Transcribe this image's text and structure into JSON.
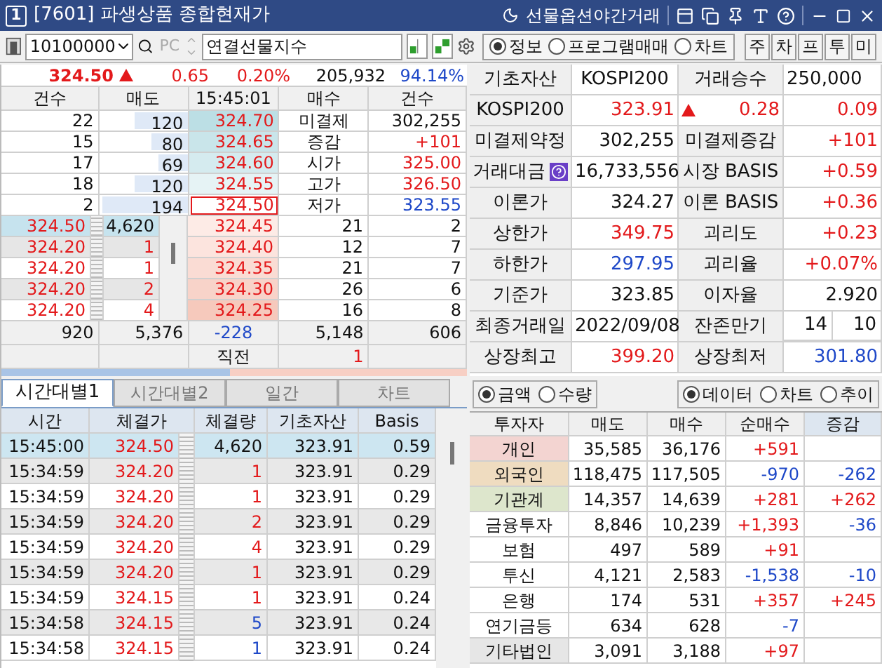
{
  "title_bar": {
    "number": "1",
    "title": "[7601] 파생상품 종합현재가",
    "night_label": "선물옵션야간거래"
  },
  "toolbar": {
    "code": "10100000",
    "pc_button": {
      "label": "PC",
      "disabled": true
    },
    "name": "연결선물지수",
    "views": [
      {
        "label": "정보",
        "selected": true
      },
      {
        "label": "프로그램매매",
        "selected": false
      },
      {
        "label": "차트",
        "selected": false
      }
    ],
    "quick_buttons": [
      "주",
      "차",
      "프",
      "투",
      "미"
    ]
  },
  "summary": {
    "price": {
      "text": "324.50",
      "color": "#e3191b"
    },
    "rising": true,
    "change": {
      "text": "0.65",
      "color": "#e3191b"
    },
    "rate": {
      "text": "0.20%",
      "color": "#e3191b"
    },
    "volume": "205,932",
    "strength": {
      "text": "94.14%",
      "color": "#1e48c8"
    }
  },
  "orderbook": {
    "columns": [
      "건수",
      "매도",
      "15:45:01",
      "매수",
      "건수"
    ],
    "asks": [
      {
        "count": "22",
        "quantity": "120",
        "price": {
          "text": "324.70",
          "color": "#e3191b"
        },
        "level": 0.6,
        "current": false
      },
      {
        "count": "15",
        "quantity": "80",
        "price": {
          "text": "324.65",
          "color": "#e3191b"
        },
        "level": 0.4,
        "current": false
      },
      {
        "count": "17",
        "quantity": "69",
        "price": {
          "text": "324.60",
          "color": "#e3191b"
        },
        "level": 0.33,
        "current": false
      },
      {
        "count": "18",
        "quantity": "120",
        "price": {
          "text": "324.55",
          "color": "#e3191b"
        },
        "level": 0.6,
        "current": false
      },
      {
        "count": "2",
        "quantity": "194",
        "price": {
          "text": "324.50",
          "color": "#e3191b"
        },
        "level": 0.97,
        "current": true
      }
    ],
    "stats": [
      {
        "label": "미결제",
        "value": "302,255"
      },
      {
        "label": "증감",
        "value": {
          "text": "+101",
          "color": "#e3191b"
        }
      },
      {
        "label": "시가",
        "value": {
          "text": "325.00",
          "color": "#e3191b"
        }
      },
      {
        "label": "고가",
        "value": {
          "text": "326.50",
          "color": "#e3191b"
        }
      },
      {
        "label": "저가",
        "value": {
          "text": "323.55",
          "color": "#1e48c8"
        }
      }
    ],
    "ticks": [
      {
        "price": {
          "text": "324.50",
          "color": "#e3191b"
        },
        "quantity": "4,620",
        "selected": true
      },
      {
        "price": {
          "text": "324.20",
          "color": "#e3191b"
        },
        "quantity": {
          "text": "1",
          "color": "#e3191b"
        },
        "selected": false
      },
      {
        "price": {
          "text": "324.20",
          "color": "#e3191b"
        },
        "quantity": {
          "text": "1",
          "color": "#e3191b"
        },
        "selected": false
      },
      {
        "price": {
          "text": "324.20",
          "color": "#e3191b"
        },
        "quantity": {
          "text": "2",
          "color": "#e3191b"
        },
        "selected": false
      },
      {
        "price": {
          "text": "324.20",
          "color": "#e3191b"
        },
        "quantity": {
          "text": "4",
          "color": "#e3191b"
        },
        "selected": false
      }
    ],
    "bids": [
      {
        "price": {
          "text": "324.45",
          "color": "#e3191b"
        },
        "quantity": "21",
        "count": "2"
      },
      {
        "price": {
          "text": "324.40",
          "color": "#e3191b"
        },
        "quantity": "12",
        "count": "7"
      },
      {
        "price": {
          "text": "324.35",
          "color": "#e3191b"
        },
        "quantity": "21",
        "count": "7"
      },
      {
        "price": {
          "text": "324.30",
          "color": "#e3191b"
        },
        "quantity": "26",
        "count": "6"
      },
      {
        "price": {
          "text": "324.25",
          "color": "#e3191b"
        },
        "quantity": "16",
        "count": "8"
      }
    ],
    "totals": [
      "920",
      "5,376",
      {
        "text": "-228",
        "color": "#1e48c8"
      },
      "5,148",
      "606"
    ],
    "previous": {
      "label": "직전",
      "value": {
        "text": "1",
        "color": "#e3191b"
      }
    },
    "balance": {
      "level": 0.49
    }
  },
  "tabs": [
    {
      "label": "시간대별1",
      "selected": true
    },
    {
      "label": "시간대별2",
      "selected": false
    },
    {
      "label": "일간",
      "selected": false
    },
    {
      "label": "차트",
      "selected": false
    }
  ],
  "trades": {
    "columns": [
      "시간",
      "체결가",
      "체결량",
      "기초자산",
      "Basis"
    ],
    "rows": [
      {
        "cells": [
          "15:45:00",
          {
            "text": "324.50",
            "color": "#e3191b"
          },
          "4,620",
          "323.91",
          "0.59"
        ],
        "selected": true
      },
      {
        "cells": [
          "15:34:59",
          {
            "text": "324.20",
            "color": "#e3191b"
          },
          {
            "text": "1",
            "color": "#e3191b"
          },
          "323.91",
          "0.29"
        ],
        "selected": false
      },
      {
        "cells": [
          "15:34:59",
          {
            "text": "324.20",
            "color": "#e3191b"
          },
          {
            "text": "1",
            "color": "#e3191b"
          },
          "323.91",
          "0.29"
        ],
        "selected": false
      },
      {
        "cells": [
          "15:34:59",
          {
            "text": "324.20",
            "color": "#e3191b"
          },
          {
            "text": "2",
            "color": "#e3191b"
          },
          "323.91",
          "0.29"
        ],
        "selected": false
      },
      {
        "cells": [
          "15:34:59",
          {
            "text": "324.20",
            "color": "#e3191b"
          },
          {
            "text": "4",
            "color": "#e3191b"
          },
          "323.91",
          "0.29"
        ],
        "selected": false
      },
      {
        "cells": [
          "15:34:59",
          {
            "text": "324.20",
            "color": "#e3191b"
          },
          {
            "text": "1",
            "color": "#e3191b"
          },
          "323.91",
          "0.29"
        ],
        "selected": false
      },
      {
        "cells": [
          "15:34:59",
          {
            "text": "324.15",
            "color": "#e3191b"
          },
          {
            "text": "1",
            "color": "#e3191b"
          },
          "323.91",
          "0.24"
        ],
        "selected": false
      },
      {
        "cells": [
          "15:34:58",
          {
            "text": "324.15",
            "color": "#e3191b"
          },
          {
            "text": "5",
            "color": "#1e48c8"
          },
          "323.91",
          "0.24"
        ],
        "selected": false
      },
      {
        "cells": [
          "15:34:58",
          {
            "text": "324.15",
            "color": "#e3191b"
          },
          {
            "text": "1",
            "color": "#1e48c8"
          },
          "323.91",
          "0.24"
        ],
        "selected": false
      }
    ]
  },
  "info": {
    "rows": [
      [
        {
          "kind": "label",
          "text": "기초자산"
        },
        {
          "kind": "value",
          "text": "KOSPI200"
        },
        {
          "kind": "label",
          "text": "거래승수"
        },
        {
          "kind": "value",
          "text": "250,000"
        }
      ],
      [
        {
          "kind": "label",
          "text": "KOSPI200"
        },
        {
          "kind": "value",
          "text": "323.91",
          "color": "#e3191b"
        },
        {
          "kind": "value",
          "text": "0.28",
          "color": "#e3191b",
          "rising": true
        },
        {
          "kind": "value",
          "text": "0.09",
          "color": "#e3191b"
        }
      ],
      [
        {
          "kind": "label",
          "text": "미결제약정"
        },
        {
          "kind": "value",
          "text": "302,255"
        },
        {
          "kind": "label",
          "text": "미결제증감"
        },
        {
          "kind": "value",
          "text": "+101",
          "color": "#e3191b"
        }
      ],
      [
        {
          "kind": "label",
          "text": "거래대금",
          "help": true
        },
        {
          "kind": "value",
          "text": "16,733,556"
        },
        {
          "kind": "label",
          "text": "시장 BASIS"
        },
        {
          "kind": "value",
          "text": "+0.59",
          "color": "#e3191b"
        }
      ],
      [
        {
          "kind": "label",
          "text": "이론가"
        },
        {
          "kind": "value",
          "text": "324.27"
        },
        {
          "kind": "label",
          "text": "이론 BASIS"
        },
        {
          "kind": "value",
          "text": "+0.36",
          "color": "#e3191b"
        }
      ],
      [
        {
          "kind": "label",
          "text": "상한가"
        },
        {
          "kind": "value",
          "text": "349.75",
          "color": "#e3191b"
        },
        {
          "kind": "label",
          "text": "괴리도"
        },
        {
          "kind": "value",
          "text": "+0.23",
          "color": "#e3191b"
        }
      ],
      [
        {
          "kind": "label",
          "text": "하한가"
        },
        {
          "kind": "value",
          "text": "297.95",
          "color": "#1e48c8"
        },
        {
          "kind": "label",
          "text": "괴리율"
        },
        {
          "kind": "value",
          "text": "+0.07%",
          "color": "#e3191b"
        }
      ],
      [
        {
          "kind": "label",
          "text": "기준가"
        },
        {
          "kind": "value",
          "text": "323.85"
        },
        {
          "kind": "label",
          "text": "이자율"
        },
        {
          "kind": "value",
          "text": "2.920"
        }
      ],
      [
        {
          "kind": "label",
          "text": "최종거래일"
        },
        {
          "kind": "value",
          "text": "2022/09/08"
        },
        {
          "kind": "label",
          "text": "잔존만기"
        },
        {
          "kind": "split",
          "parts": [
            "14",
            "10"
          ]
        }
      ],
      [
        {
          "kind": "label",
          "text": "상장최고"
        },
        {
          "kind": "value",
          "text": "399.20",
          "color": "#e3191b"
        },
        {
          "kind": "label",
          "text": "상장최저"
        },
        {
          "kind": "value",
          "text": "301.80",
          "color": "#1e48c8"
        }
      ]
    ]
  },
  "flow_options": {
    "units": [
      {
        "label": "금액",
        "selected": true
      },
      {
        "label": "수량",
        "selected": false
      }
    ],
    "views": [
      {
        "label": "데이터",
        "selected": true
      },
      {
        "label": "차트",
        "selected": false
      },
      {
        "label": "추이",
        "selected": false
      }
    ]
  },
  "investors": {
    "columns": [
      "투자자",
      "매도",
      "매수",
      "순매수",
      "증감"
    ],
    "rows": [
      {
        "name": "개인",
        "color": "#f3d4d1",
        "sell": "35,585",
        "buy": "36,176",
        "net": {
          "text": "+591",
          "color": "#e3191b"
        }
      },
      {
        "name": "외국인",
        "color": "#efdcc0",
        "sell": "118,475",
        "buy": "117,505",
        "net": {
          "text": "-970",
          "color": "#1e48c8"
        },
        "change": {
          "text": "-262",
          "color": "#1e48c8"
        }
      },
      {
        "name": "기관계",
        "color": "#dde6cc",
        "sell": "14,357",
        "buy": "14,639",
        "net": {
          "text": "+281",
          "color": "#e3191b"
        },
        "change": {
          "text": "+262",
          "color": "#e3191b"
        }
      },
      {
        "name": "금융투자",
        "sell": "8,846",
        "buy": "10,239",
        "net": {
          "text": "+1,393",
          "color": "#e3191b"
        },
        "change": {
          "text": "-36",
          "color": "#1e48c8"
        }
      },
      {
        "name": "보험",
        "sell": "497",
        "buy": "589",
        "net": {
          "text": "+91",
          "color": "#e3191b"
        }
      },
      {
        "name": "투신",
        "sell": "4,121",
        "buy": "2,583",
        "net": {
          "text": "-1,538",
          "color": "#1e48c8"
        },
        "change": {
          "text": "-10",
          "color": "#1e48c8"
        }
      },
      {
        "name": "은행",
        "sell": "174",
        "buy": "531",
        "net": {
          "text": "+357",
          "color": "#e3191b"
        },
        "change": {
          "text": "+245",
          "color": "#e3191b"
        }
      },
      {
        "name": "연기금등",
        "sell": "634",
        "buy": "628",
        "net": {
          "text": "-7",
          "color": "#1e48c8"
        }
      },
      {
        "name": "기타법인",
        "color": "#e6e6e6",
        "sell": "3,091",
        "buy": "3,188",
        "net": {
          "text": "+97",
          "color": "#e3191b"
        }
      }
    ]
  }
}
